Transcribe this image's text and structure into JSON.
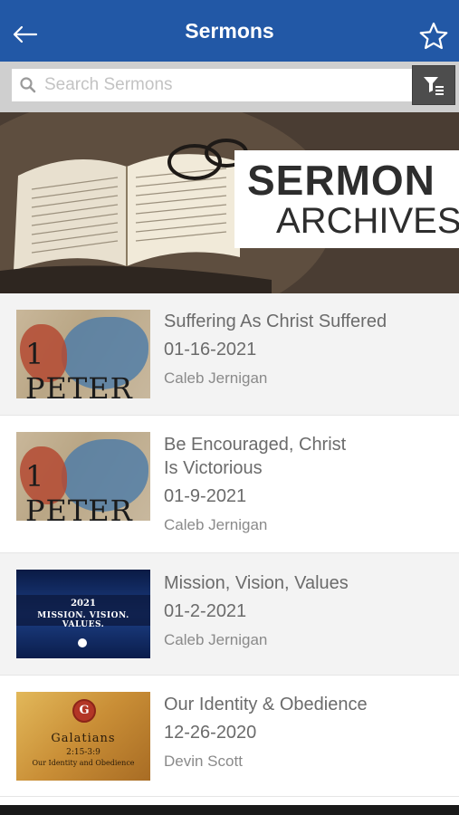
{
  "header": {
    "title": "Sermons",
    "back_icon": "back-arrow-icon",
    "favorite_icon": "star-icon",
    "color": "#2258a6"
  },
  "search": {
    "placeholder": "Search Sermons",
    "search_icon": "search-icon",
    "filter_icon": "filter-icon"
  },
  "banner": {
    "line1": "SERMON",
    "line2": "ARCHIVES"
  },
  "sermons": [
    {
      "title": "Suffering As Christ Suffered",
      "date": "01-16-2021",
      "speaker": "Caleb Jernigan",
      "thumbnail_text": "1 PETER"
    },
    {
      "title": "Be Encouraged, Christ Is Victorious",
      "title_line1": "Be Encouraged, Christ",
      "title_line2": "Is Victorious",
      "date": "01-9-2021",
      "speaker": "Caleb Jernigan",
      "thumbnail_text": "1 PETER"
    },
    {
      "title": "Mission, Vision, Values",
      "date": "01-2-2021",
      "speaker": "Caleb Jernigan",
      "thumbnail_year": "2021",
      "thumbnail_text": "MISSION. VISION. VALUES."
    },
    {
      "title": "Our Identity & Obedience",
      "date": "12-26-2020",
      "speaker": "Devin Scott",
      "thumbnail_seal": "G",
      "thumbnail_book": "Galatians",
      "thumbnail_ref": "2:15-3:9",
      "thumbnail_subtitle": "Our Identity and Obedience"
    }
  ]
}
